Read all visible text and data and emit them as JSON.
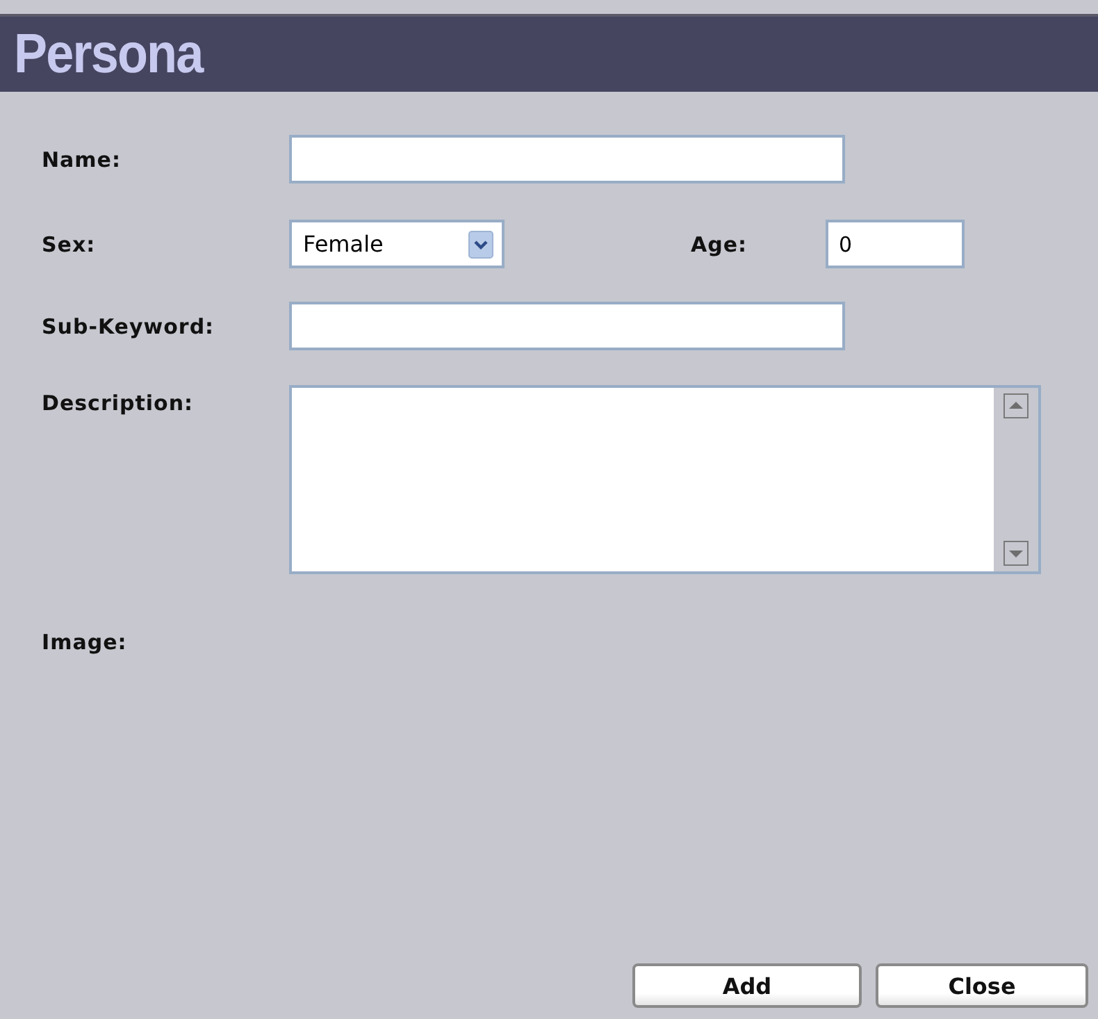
{
  "title": "Persona",
  "name": {
    "label": "Name:"
  },
  "sex": {
    "label": "Sex:",
    "value": "Female"
  },
  "age": {
    "label": "Age:",
    "value": "0"
  },
  "sub_keyword": {
    "label": "Sub-Keyword:"
  },
  "description": {
    "label": "Description:"
  },
  "image": {
    "label": "Image:"
  },
  "buttons": [
    "Add",
    "Close"
  ]
}
